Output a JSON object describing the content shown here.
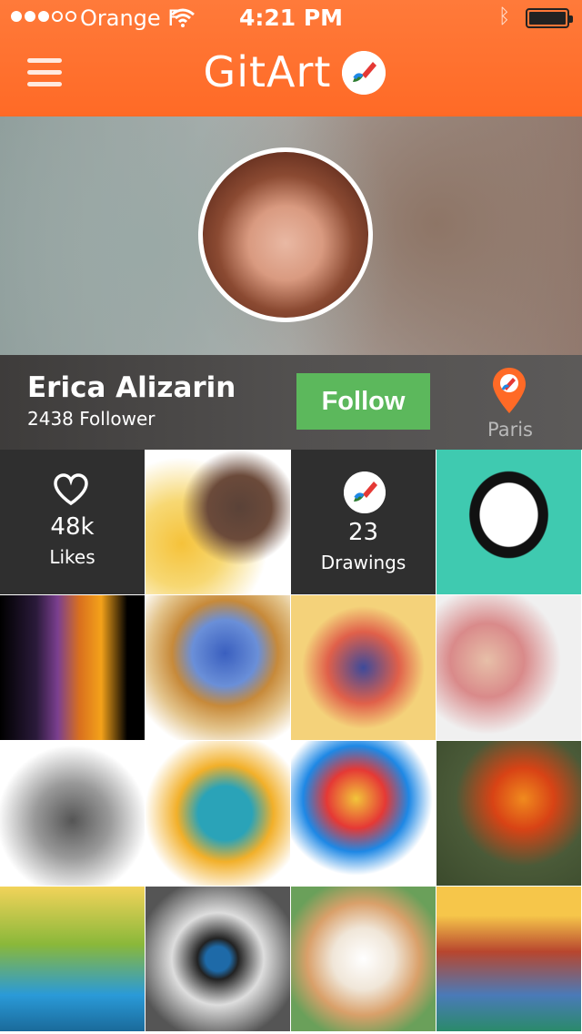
{
  "status_bar": {
    "carrier": "Orange F",
    "time": "4:21 PM"
  },
  "nav": {
    "app_title": "GitArt",
    "menu_icon": "hamburger-menu-icon",
    "logo_icon": "paintbrush-logo-icon"
  },
  "profile": {
    "name": "Erica Alizarin",
    "followers": "2438 Follower",
    "follow_label": "Follow",
    "location": "Paris",
    "location_icon": "map-pin-icon"
  },
  "stats": {
    "likes_value": "48k",
    "likes_label": "Likes",
    "likes_icon": "heart-icon",
    "drawings_value": "23",
    "drawings_label": "Drawings",
    "drawings_icon": "paintbrush-logo-icon"
  },
  "colors": {
    "header": "#ff6a26",
    "follow_button": "#5cb85c",
    "stat_tile": "#2f2f2f",
    "location_pin": "#ff6a26"
  },
  "artworks": [
    {
      "name": "artwork-man-sunglasses"
    },
    {
      "name": "artwork-woman-round-glasses"
    },
    {
      "name": "artwork-split-face"
    },
    {
      "name": "artwork-leopard"
    },
    {
      "name": "artwork-colorful-creatures"
    },
    {
      "name": "artwork-children-portrait"
    },
    {
      "name": "artwork-basketball-player"
    },
    {
      "name": "artwork-dog"
    },
    {
      "name": "artwork-woman-colorful-hair"
    },
    {
      "name": "artwork-butterfly-flowers"
    },
    {
      "name": "artwork-waterfall-landscape"
    },
    {
      "name": "artwork-eye"
    },
    {
      "name": "artwork-floral-scene"
    },
    {
      "name": "artwork-house-illustration"
    }
  ]
}
